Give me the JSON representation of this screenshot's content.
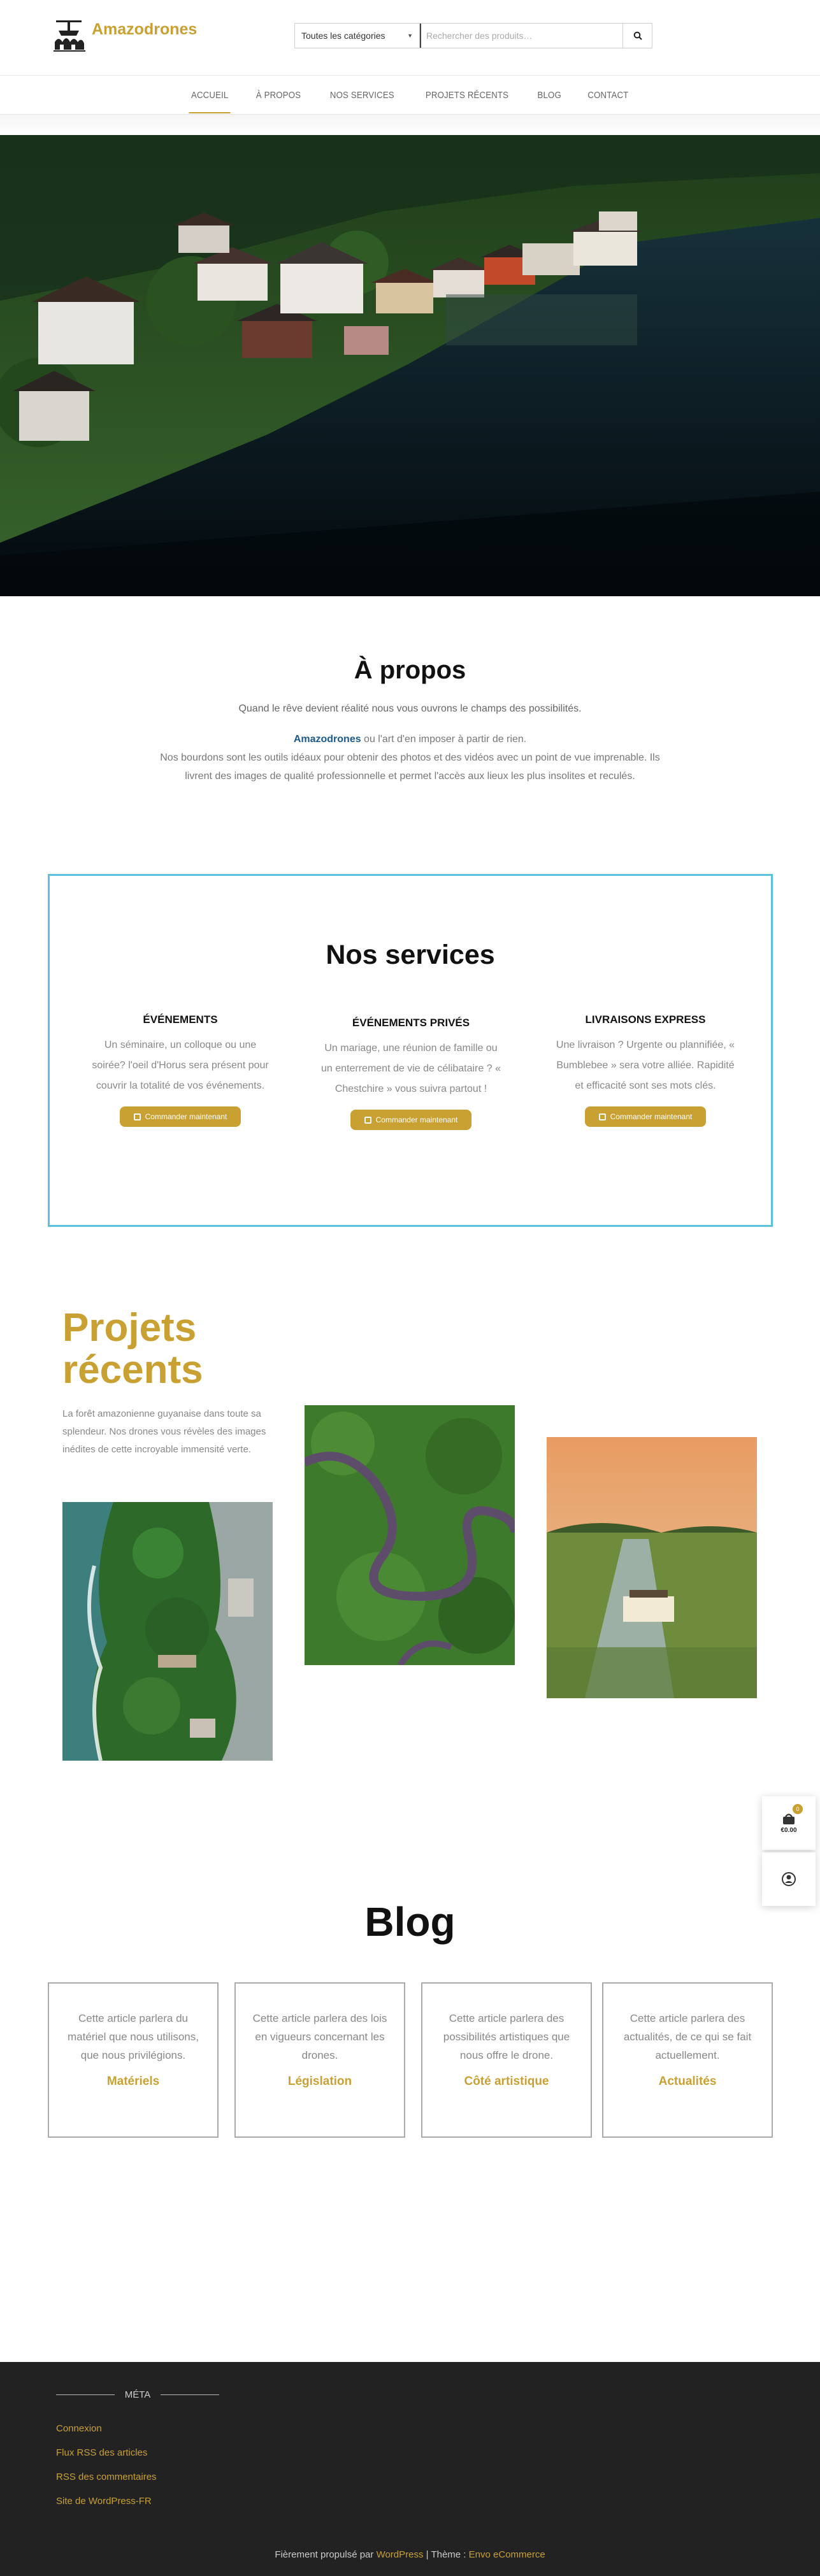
{
  "header": {
    "site_title": "Amazodrones",
    "category_select": "Toutes les catégories",
    "search_placeholder": "Rechercher des produits…"
  },
  "nav": {
    "items": [
      {
        "label": "Accueil"
      },
      {
        "label": "À propos"
      },
      {
        "label": "Nos services"
      },
      {
        "label": "Projets récents"
      },
      {
        "label": "Blog"
      },
      {
        "label": "Contact"
      }
    ]
  },
  "about": {
    "title": "À propos",
    "subtitle": "Quand le rêve devient réalité nous vous ouvrons le champs des possibilités.",
    "brand": "Amazodrones",
    "line1": " ou l'art d'en imposer à partir de rien.",
    "body": "Nos bourdons sont les outils idéaux pour obtenir des photos et des vidéos avec un point de vue imprenable. Ils livrent des images de qualité professionnelle et permet l'accès aux lieux les plus insolites et reculés."
  },
  "services": {
    "title": "Nos services",
    "items": [
      {
        "heading": "Événements",
        "text": "Un séminaire, un colloque ou une soirée? l'oeil d'Horus sera présent pour couvrir la totalité de vos événements.",
        "button": "Commander maintenant"
      },
      {
        "heading": "Événements privés",
        "text": "Un mariage, une réunion de famille ou un enterrement de vie de célibataire ? « Chestchire » vous suivra partout !",
        "button": "Commander maintenant"
      },
      {
        "heading": "Livraisons express",
        "text": "Une livraison ? Urgente ou plannifiée, « Bumblebee » sera votre alliée. Rapidité et efficacité sont ses mots clés.",
        "button": "Commander maintenant"
      }
    ]
  },
  "projects": {
    "title_line1": "Projets",
    "title_line2": "récents",
    "text": "La forêt amazonienne guyanaise dans toute sa splendeur. Nos drones vous révèles des images inédites de cette incroyable immensité verte."
  },
  "cart": {
    "count": "0",
    "price": "€0.00"
  },
  "blog": {
    "title": "Blog",
    "cards": [
      {
        "text": "Cette article parlera du matériel que nous utilisons, que nous privilégions.",
        "link": "Matériels"
      },
      {
        "text": "Cette article parlera des lois en vigueurs concernant les drones.",
        "link": "Législation"
      },
      {
        "text": "Cette article parlera des possibilités artistiques que nous offre le drone.",
        "link": "Côté artistique"
      },
      {
        "text": "Cette article parlera des actualités, de ce qui se fait actuellement.",
        "link": "Actualités"
      }
    ]
  },
  "footer": {
    "meta_title": "Méta",
    "meta_links": [
      "Connexion",
      "Flux RSS des articles",
      "RSS des commentaires",
      "Site de WordPress-FR"
    ],
    "credit_prefix": "Fièrement propulsé par ",
    "credit_wp": "WordPress",
    "credit_mid": " | Thème : ",
    "credit_theme": "Envo eCommerce"
  },
  "colors": {
    "accent": "#c9a032",
    "services_border": "#5bc2db",
    "footer_bg": "#222222",
    "brand_link": "#1c5a8a"
  }
}
